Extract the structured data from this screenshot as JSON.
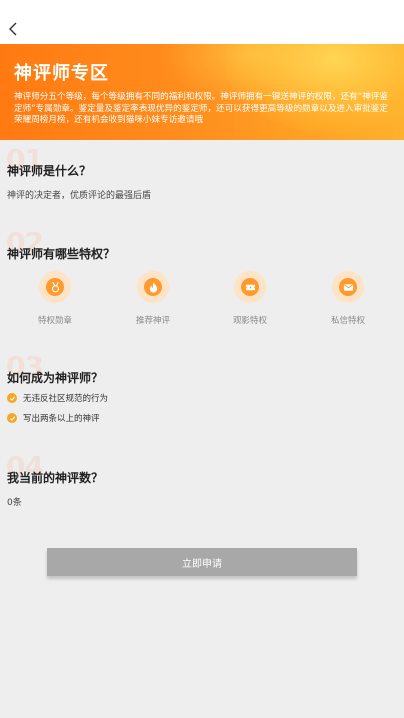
{
  "banner": {
    "title": "神评师专区",
    "description": "神评师分五个等级，每个等级拥有不同的福利和权限。神评师拥有一键送神评的权限，还有“神评鉴定师”专属勋章。鉴定量及鉴定率表现优异的鉴定师，还可以获得更高等级的勋章以及进入审批鉴定荣耀周榜月榜，还有机会收到猫咪小妹专访邀请哦"
  },
  "sections": [
    {
      "number": "01",
      "heading": "神评师是什么？",
      "body": "神评的决定者，优质评论的最强后盾"
    },
    {
      "number": "02",
      "heading": "神评师有哪些特权？"
    },
    {
      "number": "03",
      "heading": "如何成为神评师？"
    },
    {
      "number": "04",
      "heading": "我当前的神评数？",
      "body": "0条"
    }
  ],
  "privileges": [
    {
      "icon": "medal-icon",
      "label": "特权勋章"
    },
    {
      "icon": "fire-icon",
      "label": "推荐神评"
    },
    {
      "icon": "ticket-icon",
      "label": "观影特权"
    },
    {
      "icon": "mail-icon",
      "label": "私信特权"
    }
  ],
  "conditions": [
    {
      "icon": "check-icon",
      "text": "无违反社区规范的行为"
    },
    {
      "icon": "check-icon",
      "text": "写出两条以上的神评"
    }
  ],
  "apply_button": {
    "label": "立即申请"
  },
  "colors": {
    "accent": "#ff8a1e",
    "icon_bg": "#fde4c6",
    "button": "#a8a8a8",
    "page_bg": "#eeeeee"
  }
}
